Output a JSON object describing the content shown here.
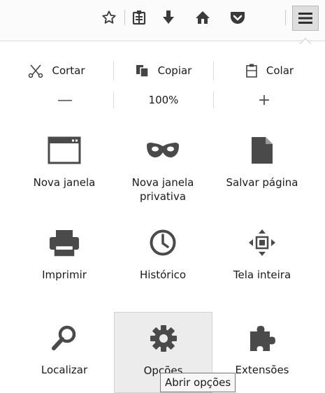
{
  "toolbar": {
    "buttons": [
      "bookmark-star-icon",
      "reader-list-icon",
      "downloads-icon",
      "home-icon",
      "pocket-icon",
      "menu-hamburger-icon"
    ]
  },
  "edit": {
    "cut": "Cortar",
    "copy": "Copiar",
    "paste": "Colar"
  },
  "zoom": {
    "out": "—",
    "level": "100%",
    "in": "+"
  },
  "grid": {
    "new_window": "Nova janela",
    "private_window": "Nova janela privativa",
    "save_page": "Salvar página",
    "print": "Imprimir",
    "history": "Histórico",
    "fullscreen": "Tela inteira",
    "find": "Localizar",
    "options": "Opções",
    "addons": "Extensões"
  },
  "tooltip": "Abrir opções",
  "colors": {
    "icon": "#4a4a4a",
    "hover_bg": "#ececec",
    "toolbar_bg": "#fbfbfb"
  }
}
